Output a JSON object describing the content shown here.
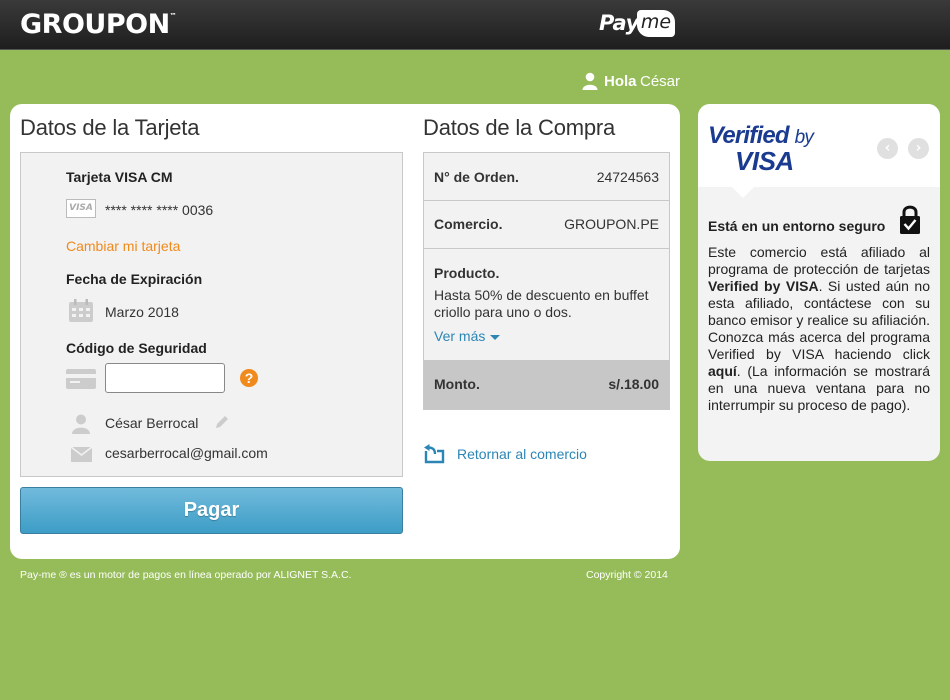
{
  "header": {
    "brand_logo": "GROUPON",
    "brand_trademark": "™",
    "payme_logo_pay": "Pay",
    "payme_logo_me": "me"
  },
  "greeting": {
    "hola": "Hola",
    "name": "César"
  },
  "card_section": {
    "title": "Datos de la Tarjeta",
    "card_name": "Tarjeta VISA CM",
    "card_icon_label": "VISA",
    "masked_number": "**** **** **** 0036",
    "change_card_link": "Cambiar mi tarjeta",
    "expiration_label": "Fecha de Expiración",
    "expiration_value": "Marzo 2018",
    "security_code_label": "Código de Seguridad",
    "security_code_value": "",
    "help_icon_text": "?",
    "holder_name": "César Berrocal",
    "holder_email": "cesarberrocal@gmail.com",
    "pay_button": "Pagar"
  },
  "purchase_section": {
    "title": "Datos de la Compra",
    "order_label": "N° de Orden.",
    "order_value": "24724563",
    "merchant_label": "Comercio.",
    "merchant_value": "GROUPON.PE",
    "product_label": "Producto.",
    "product_description": "Hasta 50% de descuento en buffet criollo para uno o dos.",
    "see_more_link": "Ver más",
    "amount_label": "Monto.",
    "amount_value": "s/.18.00",
    "return_link": "Retornar al comercio"
  },
  "verified_by_visa": {
    "logo_verified": "Verified",
    "logo_by": "by",
    "logo_visa": "VISA",
    "prev_arrow": "‹",
    "next_arrow": "›",
    "secure_title": "Está en un entorno seguro",
    "text_part1": "Este comercio está afiliado al programa de protección de tarjetas ",
    "text_bold1": "Verified by VISA",
    "text_part2": ". Si usted aún no esta afiliado, contáctese con su banco emisor y realice su afiliación. Conozca más acerca del programa Verified by VISA haciendo click ",
    "text_bold2": "aquí",
    "text_part3": ". (La información se mostrará en una nueva ventana para no interrumpir su proceso de pago)."
  },
  "footer": {
    "left_text": "Pay-me ® es un motor de pagos en línea operado por ALIGNET S.A.C.",
    "right_text": "Copyright © 2014"
  },
  "colors": {
    "background_green": "#96bc5a",
    "pay_button_blue": "#4ea8d0",
    "link_orange": "#f08a1c",
    "link_blue": "#2b86b5",
    "visa_blue": "#1a3b8f",
    "visa_gold": "#f0a81c"
  },
  "icons": [
    "user-icon",
    "visa-card-icon",
    "calendar-icon",
    "credit-card-icon",
    "help-icon",
    "person-icon",
    "pencil-icon",
    "mail-icon",
    "return-icon",
    "caret-down-icon",
    "lock-check-icon",
    "chevron-left-icon",
    "chevron-right-icon"
  ]
}
